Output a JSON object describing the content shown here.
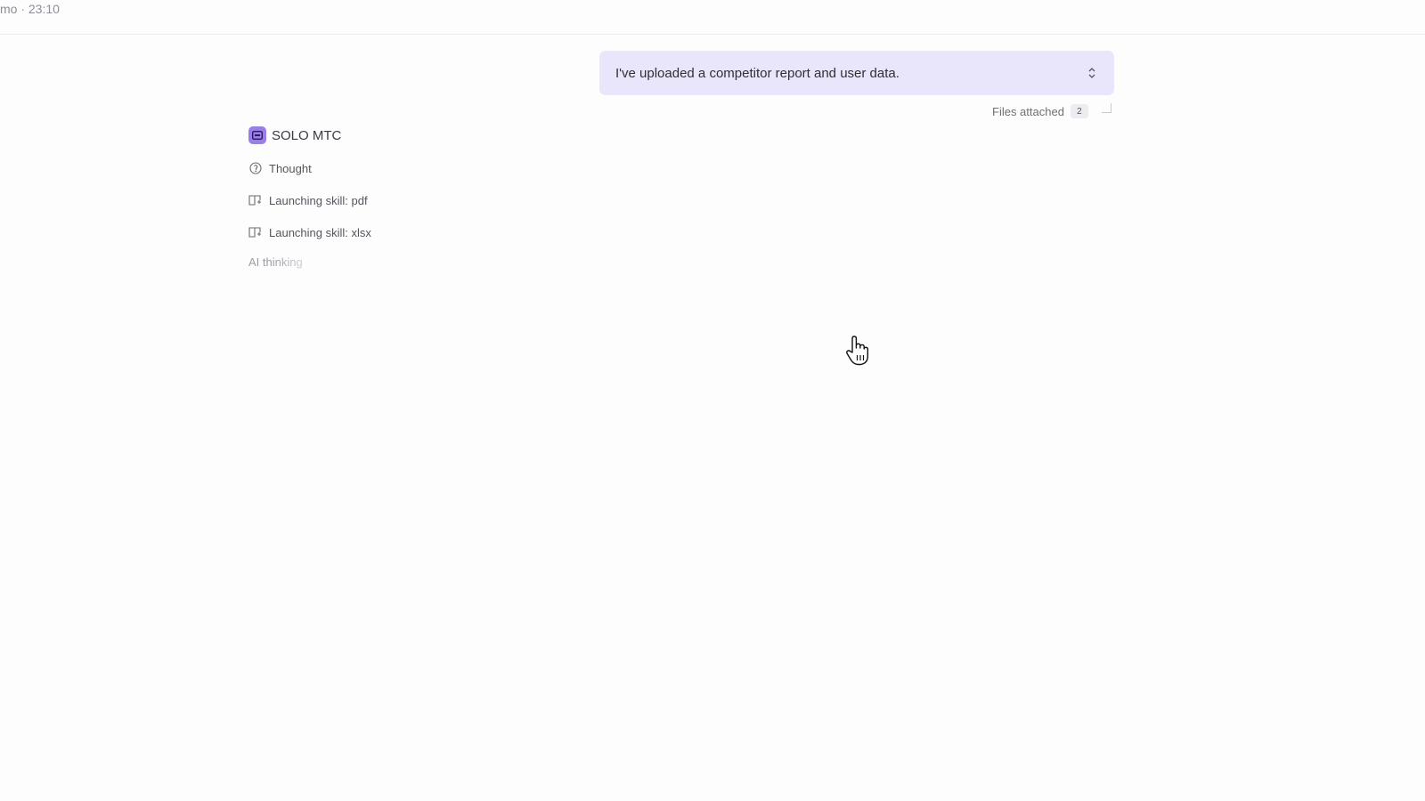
{
  "topbar": {
    "title": "mo · 23:10"
  },
  "user_message": {
    "text": "I've uploaded a competitor report and user data."
  },
  "attachments": {
    "label": "Files attached",
    "count": "2"
  },
  "agent": {
    "name": "SOLO MTC",
    "steps": [
      {
        "icon": "lightbulb-icon",
        "label": "Thought"
      },
      {
        "icon": "skill-book-icon",
        "label": "Launching skill: pdf"
      },
      {
        "icon": "skill-book-icon",
        "label": "Launching skill: xlsx"
      }
    ],
    "status": "AI thinking"
  },
  "colors": {
    "accent": "#9c7ee9",
    "user_bubble": "#e9e6fb"
  }
}
